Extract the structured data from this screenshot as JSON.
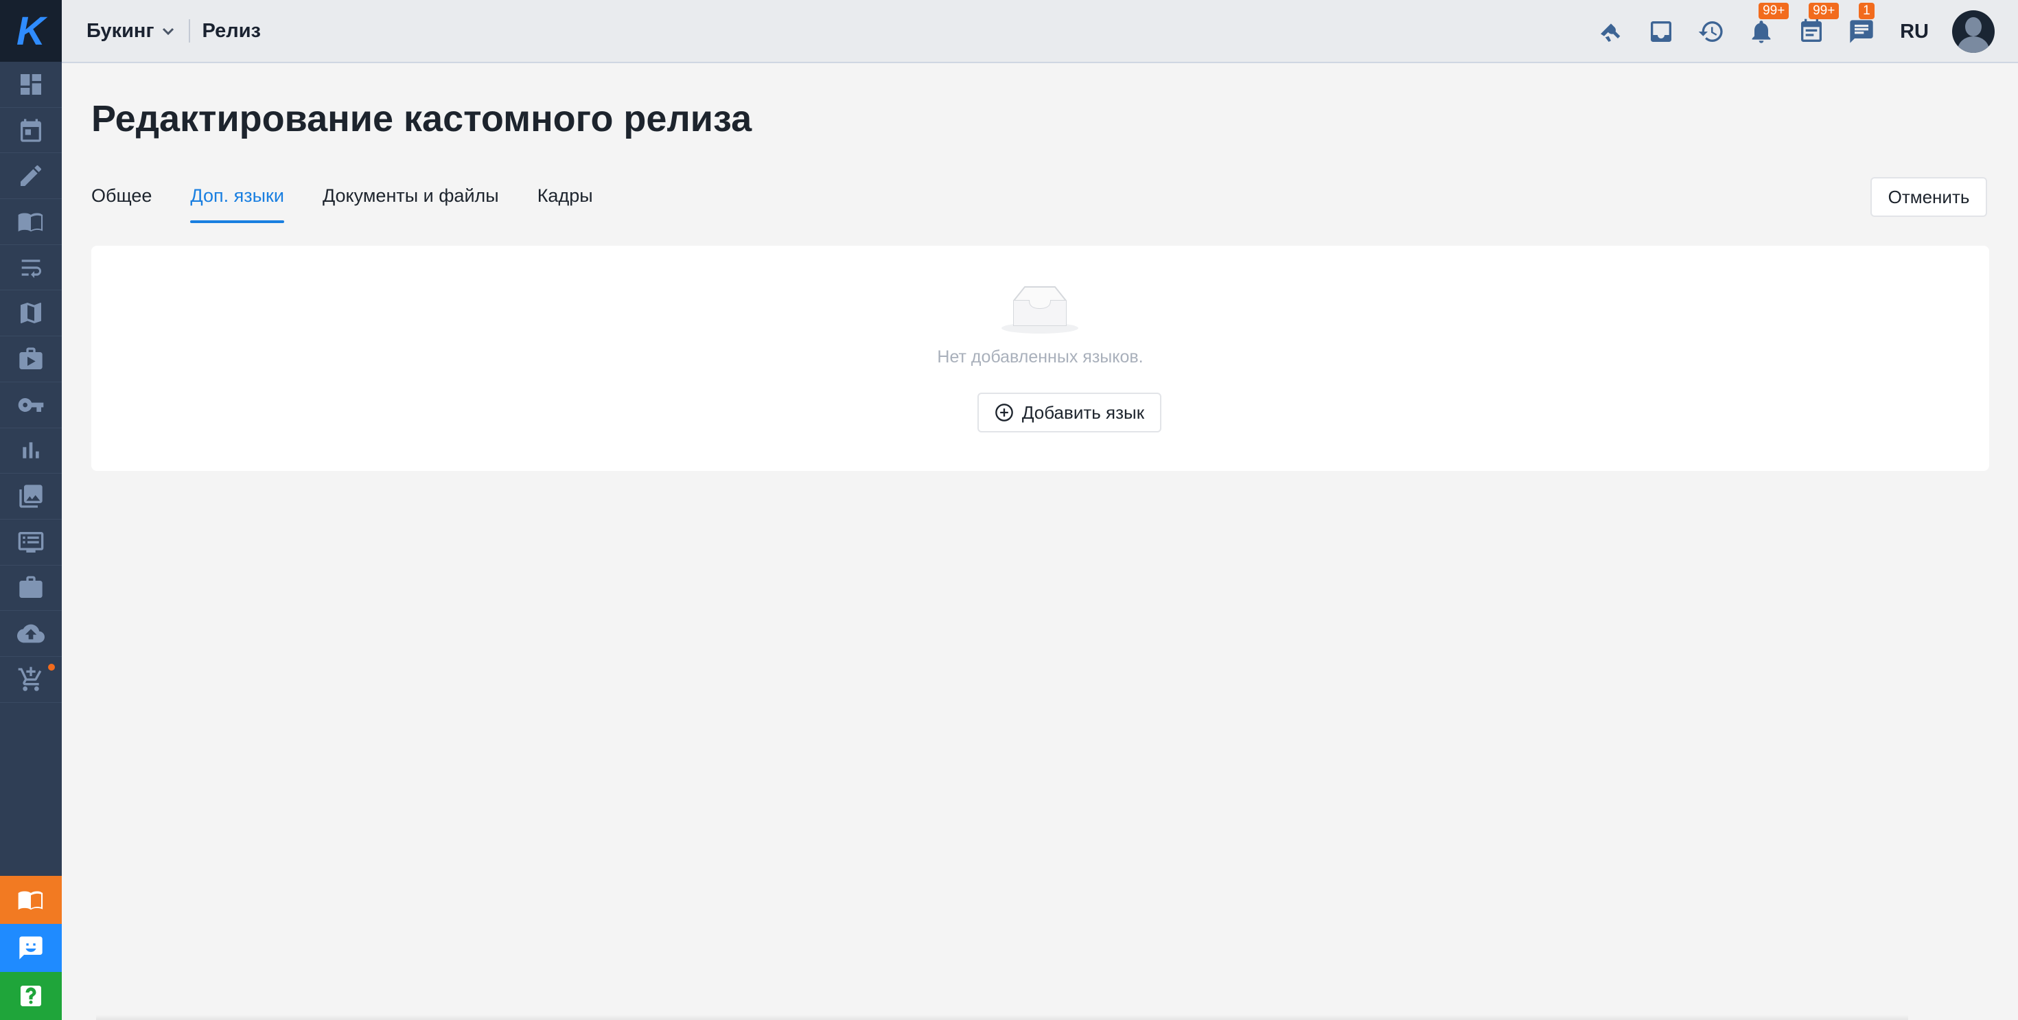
{
  "sidebar": {
    "logo_text": "K",
    "items": [
      {
        "icon": "dashboard-icon"
      },
      {
        "icon": "calendar-icon"
      },
      {
        "icon": "pencil-icon"
      },
      {
        "icon": "book-icon"
      },
      {
        "icon": "wrap-text-icon"
      },
      {
        "icon": "map-icon"
      },
      {
        "icon": "video-folder-icon"
      },
      {
        "icon": "key-icon"
      },
      {
        "icon": "bar-chart-icon"
      },
      {
        "icon": "photo-library-icon"
      },
      {
        "icon": "monitor-list-icon"
      },
      {
        "icon": "briefcase-icon"
      },
      {
        "icon": "cloud-upload-icon"
      },
      {
        "icon": "cart-add-icon",
        "has_dot": true
      }
    ],
    "bottom_buttons": [
      {
        "icon": "book-open-icon",
        "color": "#f27a22"
      },
      {
        "icon": "chat-smile-icon",
        "color": "#1f8bff"
      },
      {
        "icon": "help-icon",
        "color": "#1fa53a"
      }
    ]
  },
  "topbar": {
    "project": "Букинг",
    "section": "Релиз",
    "notifications_badge": "99+",
    "tasks_badge": "99+",
    "messages_badge": "1",
    "language": "RU"
  },
  "page": {
    "title": "Редактирование кастомного релиза",
    "tabs": [
      "Общее",
      "Доп. языки",
      "Документы и файлы",
      "Кадры"
    ],
    "active_tab": "Доп. языки",
    "cancel_label": "Отменить",
    "empty_text": "Нет добавленных языков.",
    "add_language_label": "Добавить язык"
  },
  "colors": {
    "accent": "#1a7fe0",
    "sidebar_bg": "#2f3e55",
    "badge": "#f26b1d"
  }
}
